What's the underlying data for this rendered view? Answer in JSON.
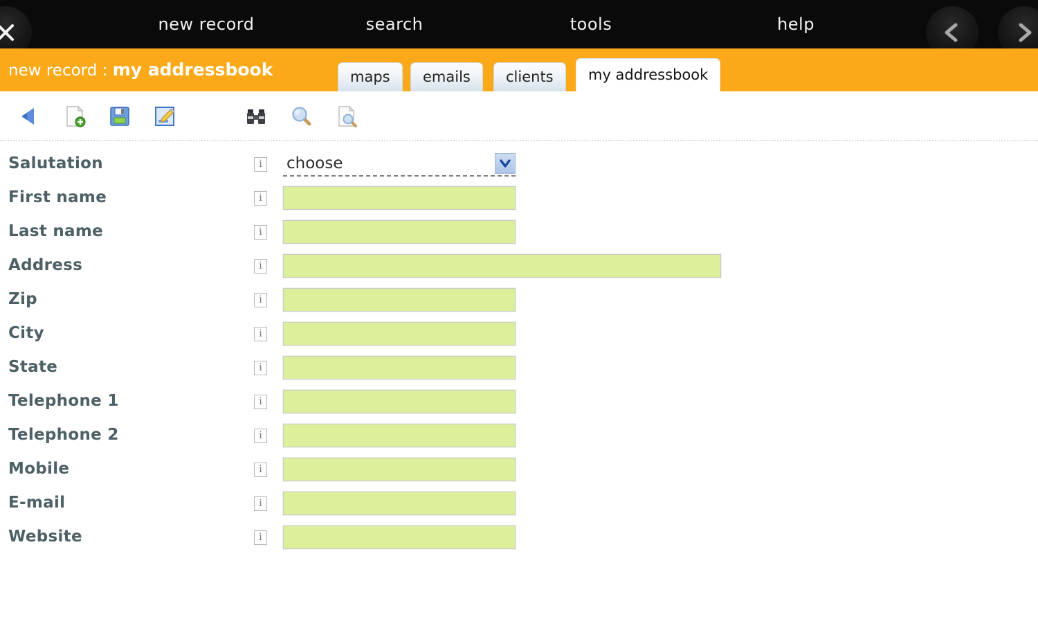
{
  "topbar": {
    "close_icon": "close-x-icon",
    "menu": [
      {
        "label": "new record"
      },
      {
        "label": "search"
      },
      {
        "label": "tools"
      },
      {
        "label": "help"
      }
    ],
    "prev_icon": "chevron-left-icon",
    "next_icon": "chevron-right-icon"
  },
  "header": {
    "breadcrumb_prefix": "new record : ",
    "breadcrumb_title": "my addressbook",
    "background_color": "#FBA919",
    "tabs": [
      {
        "label": "maps",
        "active": false
      },
      {
        "label": "emails",
        "active": false
      },
      {
        "label": "clients",
        "active": false
      },
      {
        "label": "my addressbook",
        "active": true
      }
    ]
  },
  "toolbar": {
    "buttons": [
      {
        "name": "back-button",
        "icon": "back-arrow-icon"
      },
      {
        "name": "new-record-button",
        "icon": "new-document-icon"
      },
      {
        "name": "save-button",
        "icon": "save-floppy-icon"
      },
      {
        "name": "edit-button",
        "icon": "edit-document-icon"
      },
      {
        "name": "browse-button",
        "icon": "binoculars-icon"
      },
      {
        "name": "search-button",
        "icon": "magnifier-icon"
      },
      {
        "name": "preview-button",
        "icon": "document-search-icon"
      }
    ]
  },
  "form": {
    "info_glyph": "i",
    "field_color": "#dcf09c",
    "rows": [
      {
        "label": "Salutation",
        "type": "select",
        "value": "choose",
        "width": "normal"
      },
      {
        "label": "First name",
        "type": "text",
        "value": "",
        "width": "normal"
      },
      {
        "label": "Last name",
        "type": "text",
        "value": "",
        "width": "normal"
      },
      {
        "label": "Address",
        "type": "text",
        "value": "",
        "width": "wide"
      },
      {
        "label": "Zip",
        "type": "text",
        "value": "",
        "width": "normal"
      },
      {
        "label": "City",
        "type": "text",
        "value": "",
        "width": "normal"
      },
      {
        "label": "State",
        "type": "text",
        "value": "",
        "width": "normal"
      },
      {
        "label": "Telephone 1",
        "type": "text",
        "value": "",
        "width": "normal"
      },
      {
        "label": "Telephone 2",
        "type": "text",
        "value": "",
        "width": "normal"
      },
      {
        "label": "Mobile",
        "type": "text",
        "value": "",
        "width": "normal"
      },
      {
        "label": "E-mail",
        "type": "text",
        "value": "",
        "width": "normal"
      },
      {
        "label": "Website",
        "type": "text",
        "value": "",
        "width": "normal"
      }
    ]
  }
}
